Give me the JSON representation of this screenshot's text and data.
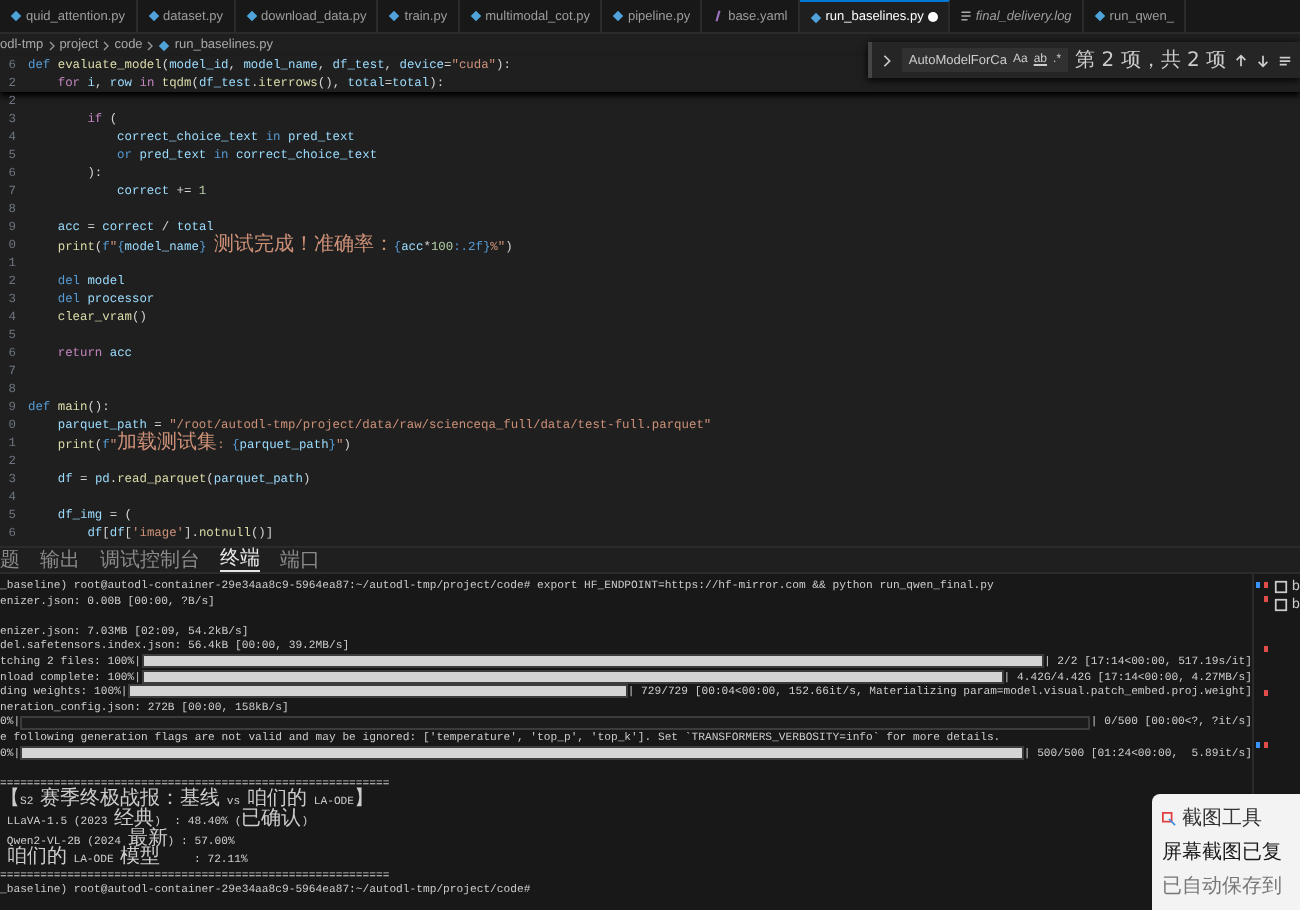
{
  "tabs": [
    {
      "label": "quid_attention.py",
      "kind": "python",
      "selected": false,
      "modified": false,
      "preview": false
    },
    {
      "label": "dataset.py",
      "kind": "python",
      "selected": false,
      "modified": false,
      "preview": false
    },
    {
      "label": "download_data.py",
      "kind": "python",
      "selected": false,
      "modified": false,
      "preview": false
    },
    {
      "label": "train.py",
      "kind": "python",
      "selected": false,
      "modified": false,
      "preview": false
    },
    {
      "label": "multimodal_cot.py",
      "kind": "python",
      "selected": false,
      "modified": false,
      "preview": false
    },
    {
      "label": "pipeline.py",
      "kind": "python",
      "selected": false,
      "modified": false,
      "preview": false
    },
    {
      "label": "base.yaml",
      "kind": "yaml",
      "selected": false,
      "modified": false,
      "preview": false
    },
    {
      "label": "run_baselines.py",
      "kind": "python",
      "selected": true,
      "modified": true,
      "preview": false
    },
    {
      "label": "final_delivery.log",
      "kind": "log",
      "selected": false,
      "modified": false,
      "preview": true
    },
    {
      "label": "run_qwen_",
      "kind": "python",
      "selected": false,
      "modified": false,
      "preview": false
    }
  ],
  "breadcrumb": [
    "odl-tmp",
    "project",
    "code",
    "run_baselines.py"
  ],
  "find_widget": {
    "value": "AutoModelForCa",
    "match_case": "Aa",
    "whole_word": "ab",
    "regex": ".*",
    "result": "第 2 项，共 2 项"
  },
  "sticky_lines": [
    {
      "no": "6",
      "segments": [
        {
          "kind": "kw",
          "text": "def "
        },
        {
          "kind": "fn",
          "text": "evaluate_model"
        },
        {
          "kind": "plain",
          "text": "("
        },
        {
          "kind": "var",
          "text": "model_id"
        },
        {
          "kind": "plain",
          "text": ", "
        },
        {
          "kind": "var",
          "text": "model_name"
        },
        {
          "kind": "plain",
          "text": ", "
        },
        {
          "kind": "var",
          "text": "df_test"
        },
        {
          "kind": "plain",
          "text": ", "
        },
        {
          "kind": "var",
          "text": "device"
        },
        {
          "kind": "plain",
          "text": "="
        },
        {
          "kind": "str",
          "text": "\"cuda\""
        },
        {
          "kind": "plain",
          "text": "):"
        }
      ]
    },
    {
      "no": "2",
      "segments": [
        {
          "kind": "ctl",
          "text": "    for "
        },
        {
          "kind": "var",
          "text": "i"
        },
        {
          "kind": "plain",
          "text": ", "
        },
        {
          "kind": "var",
          "text": "row "
        },
        {
          "kind": "ctl",
          "text": "in "
        },
        {
          "kind": "fn",
          "text": "tqdm"
        },
        {
          "kind": "plain",
          "text": "("
        },
        {
          "kind": "var",
          "text": "df_test"
        },
        {
          "kind": "plain",
          "text": "."
        },
        {
          "kind": "fn",
          "text": "iterrows"
        },
        {
          "kind": "plain",
          "text": "(), "
        },
        {
          "kind": "var",
          "text": "total"
        },
        {
          "kind": "plain",
          "text": "="
        },
        {
          "kind": "var",
          "text": "total"
        },
        {
          "kind": "plain",
          "text": "):"
        }
      ]
    }
  ],
  "code_lines": [
    {
      "no": "2"
    },
    {
      "no": "3",
      "segments": [
        {
          "kind": "ctl",
          "text": "        if "
        },
        {
          "kind": "plain",
          "text": "("
        }
      ]
    },
    {
      "no": "4",
      "segments": [
        {
          "kind": "var",
          "text": "            correct_choice_text "
        },
        {
          "kind": "kw",
          "text": "in "
        },
        {
          "kind": "var",
          "text": "pred_text"
        }
      ]
    },
    {
      "no": "5",
      "segments": [
        {
          "kind": "kw",
          "text": "            or "
        },
        {
          "kind": "var",
          "text": "pred_text "
        },
        {
          "kind": "kw",
          "text": "in "
        },
        {
          "kind": "var",
          "text": "correct_choice_text"
        }
      ]
    },
    {
      "no": "6",
      "segments": [
        {
          "kind": "plain",
          "text": "        ):"
        }
      ]
    },
    {
      "no": "7",
      "segments": [
        {
          "kind": "var",
          "text": "            correct "
        },
        {
          "kind": "plain",
          "text": "+= "
        },
        {
          "kind": "num",
          "text": "1"
        }
      ]
    },
    {
      "no": "8"
    },
    {
      "no": "9",
      "segments": [
        {
          "kind": "var",
          "text": "    acc "
        },
        {
          "kind": "plain",
          "text": "= "
        },
        {
          "kind": "var",
          "text": "correct "
        },
        {
          "kind": "plain",
          "text": "/ "
        },
        {
          "kind": "var",
          "text": "total"
        }
      ]
    },
    {
      "no": "0",
      "segments": [
        {
          "kind": "fn",
          "text": "    print"
        },
        {
          "kind": "plain",
          "text": "("
        },
        {
          "kind": "kw",
          "text": "f"
        },
        {
          "kind": "str",
          "text": "\""
        },
        {
          "kind": "kw",
          "text": "{"
        },
        {
          "kind": "var",
          "text": "model_name"
        },
        {
          "kind": "kw",
          "text": "}"
        },
        {
          "kind": "str",
          "text": " 测试完成！准确率："
        },
        {
          "kind": "kw",
          "text": "{"
        },
        {
          "kind": "var",
          "text": "acc"
        },
        {
          "kind": "plain",
          "text": "*"
        },
        {
          "kind": "num",
          "text": "100"
        },
        {
          "kind": "kw",
          "text": ":.2f}"
        },
        {
          "kind": "str",
          "text": "%\""
        },
        {
          "kind": "plain",
          "text": ")"
        }
      ]
    },
    {
      "no": "1"
    },
    {
      "no": "2",
      "segments": [
        {
          "kind": "kw",
          "text": "    del "
        },
        {
          "kind": "var",
          "text": "model"
        }
      ]
    },
    {
      "no": "3",
      "segments": [
        {
          "kind": "kw",
          "text": "    del "
        },
        {
          "kind": "var",
          "text": "processor"
        }
      ]
    },
    {
      "no": "4",
      "segments": [
        {
          "kind": "fn",
          "text": "    clear_vram"
        },
        {
          "kind": "plain",
          "text": "()"
        }
      ]
    },
    {
      "no": "5"
    },
    {
      "no": "6",
      "segments": [
        {
          "kind": "ctl",
          "text": "    return "
        },
        {
          "kind": "var",
          "text": "acc"
        }
      ]
    },
    {
      "no": "7"
    },
    {
      "no": "8"
    },
    {
      "no": "9",
      "segments": [
        {
          "kind": "kw",
          "text": "def "
        },
        {
          "kind": "fn",
          "text": "main"
        },
        {
          "kind": "plain",
          "text": "():"
        }
      ]
    },
    {
      "no": "0",
      "segments": [
        {
          "kind": "var",
          "text": "    parquet_path "
        },
        {
          "kind": "plain",
          "text": "= "
        },
        {
          "kind": "str",
          "text": "\"/root/autodl-tmp/project/data/raw/scienceqa_full/data/test-full.parquet\""
        }
      ]
    },
    {
      "no": "1",
      "segments": [
        {
          "kind": "fn",
          "text": "    print"
        },
        {
          "kind": "plain",
          "text": "("
        },
        {
          "kind": "kw",
          "text": "f"
        },
        {
          "kind": "str",
          "text": "\"加载测试集: "
        },
        {
          "kind": "kw",
          "text": "{"
        },
        {
          "kind": "var",
          "text": "parquet_path"
        },
        {
          "kind": "kw",
          "text": "}"
        },
        {
          "kind": "str",
          "text": "\""
        },
        {
          "kind": "plain",
          "text": ")"
        }
      ]
    },
    {
      "no": "2"
    },
    {
      "no": "3",
      "segments": [
        {
          "kind": "var",
          "text": "    df "
        },
        {
          "kind": "plain",
          "text": "= "
        },
        {
          "kind": "var",
          "text": "pd"
        },
        {
          "kind": "plain",
          "text": "."
        },
        {
          "kind": "fn",
          "text": "read_parquet"
        },
        {
          "kind": "plain",
          "text": "("
        },
        {
          "kind": "var",
          "text": "parquet_path"
        },
        {
          "kind": "plain",
          "text": ")"
        }
      ]
    },
    {
      "no": "4"
    },
    {
      "no": "5",
      "segments": [
        {
          "kind": "var",
          "text": "    df_img "
        },
        {
          "kind": "plain",
          "text": "= ("
        }
      ]
    },
    {
      "no": "6",
      "segments": [
        {
          "kind": "var",
          "text": "        df"
        },
        {
          "kind": "plain",
          "text": "["
        },
        {
          "kind": "var",
          "text": "df"
        },
        {
          "kind": "plain",
          "text": "["
        },
        {
          "kind": "str",
          "text": "'image'"
        },
        {
          "kind": "plain",
          "text": "]."
        },
        {
          "kind": "fn",
          "text": "notnull"
        },
        {
          "kind": "plain",
          "text": "()]"
        }
      ]
    }
  ],
  "panel_tabs": [
    {
      "label": "题",
      "selected": false
    },
    {
      "label": "输出",
      "selected": false
    },
    {
      "label": "调试控制台",
      "selected": false
    },
    {
      "label": "终端",
      "selected": true
    },
    {
      "label": "端口",
      "selected": false
    }
  ],
  "terminal_lines": [
    {
      "kind": "text",
      "text": "_baseline) root@autodl-container-29e34aa8c9-5964ea87:~/autodl-tmp/project/code# export HF_ENDPOINT=https://hf-mirror.com && python run_qwen_final.py"
    },
    {
      "kind": "text",
      "text": "enizer.json: 0.00B [00:00, ?B/s]"
    },
    {
      "kind": "blank"
    },
    {
      "kind": "text",
      "text": "enizer.json: 7.03MB [02:09, 54.2kB/s]"
    },
    {
      "kind": "text",
      "text": "del.safetensors.index.json: 56.4kB [00:00, 39.2MB/s]"
    },
    {
      "kind": "progress",
      "prefix": "tching 2 files: 100%|",
      "level": 1,
      "suffix": "| 2/2 [17:14<00:00, 517.19s/it]"
    },
    {
      "kind": "progress",
      "prefix": "nload complete: 100%|",
      "level": 1,
      "suffix": "| 4.42G/4.42G [17:14<00:00, 4.27MB/s]"
    },
    {
      "kind": "progress",
      "prefix": "ding weights: 100%|",
      "level": 1,
      "suffix": "| 729/729 [00:04<00:00, 152.66it/s, Materializing param=model.visual.patch_embed.proj.weight]"
    },
    {
      "kind": "text",
      "text": "neration_config.json: 272B [00:00, 158kB/s]"
    },
    {
      "kind": "progress",
      "prefix": "0%|",
      "level": 0,
      "suffix": "| 0/500 [00:00<?, ?it/s]"
    },
    {
      "kind": "text",
      "text": "e following generation flags are not valid and may be ignored: ['temperature', 'top_p', 'top_k']. Set `TRANSFORMERS_VERBOSITY=info` for more details."
    },
    {
      "kind": "progress",
      "prefix": "0%|",
      "level": 1,
      "suffix": "| 500/500 [01:24<00:00,  5.89it/s]"
    },
    {
      "kind": "blank"
    },
    {
      "kind": "text",
      "text": "=========================================================="
    },
    {
      "kind": "text",
      "text": "【S2 赛季终极战报：基线 vs 咱们的 LA-ODE】"
    },
    {
      "kind": "text",
      "text": " LLaVA-1.5 (2023 经典)  : 48.40% (已确认)"
    },
    {
      "kind": "text",
      "text": " Qwen2-VL-2B (2024 最新) : 57.00%"
    },
    {
      "kind": "text",
      "text": " 咱们的 LA-ODE 模型     : 72.11%"
    },
    {
      "kind": "text",
      "text": "=========================================================="
    },
    {
      "kind": "text",
      "text": "_baseline) root@autodl-container-29e34aa8c9-5964ea87:~/autodl-tmp/project/code#"
    }
  ],
  "terminal_list": [
    {
      "label": "b"
    },
    {
      "label": "b"
    }
  ],
  "notification": {
    "app": "截图工具",
    "title": "屏幕截图已复",
    "body": "已自动保存到"
  }
}
